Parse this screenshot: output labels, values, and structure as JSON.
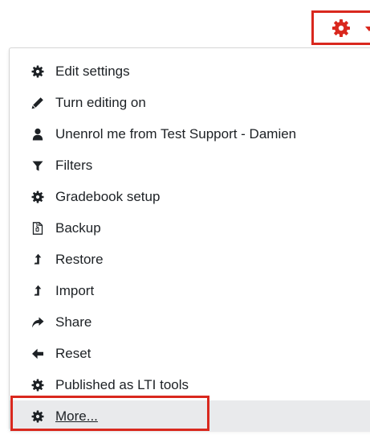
{
  "toggle": {
    "icon": "gear-icon",
    "accent_color": "#d9281e"
  },
  "menu": {
    "items": [
      {
        "label": "Edit settings",
        "icon": "gear-icon"
      },
      {
        "label": "Turn editing on",
        "icon": "pencil-icon"
      },
      {
        "label": "Unenrol me from Test Support - Damien",
        "icon": "user-icon"
      },
      {
        "label": "Filters",
        "icon": "filter-icon"
      },
      {
        "label": "Gradebook setup",
        "icon": "gear-icon"
      },
      {
        "label": "Backup",
        "icon": "file-archive-icon"
      },
      {
        "label": "Restore",
        "icon": "level-up-icon"
      },
      {
        "label": "Import",
        "icon": "level-up-icon"
      },
      {
        "label": "Share",
        "icon": "share-icon"
      },
      {
        "label": "Reset",
        "icon": "arrow-left-icon"
      },
      {
        "label": "Published as LTI tools",
        "icon": "gear-icon"
      },
      {
        "label": "More...",
        "icon": "gear-icon",
        "highlighted": true
      }
    ]
  }
}
